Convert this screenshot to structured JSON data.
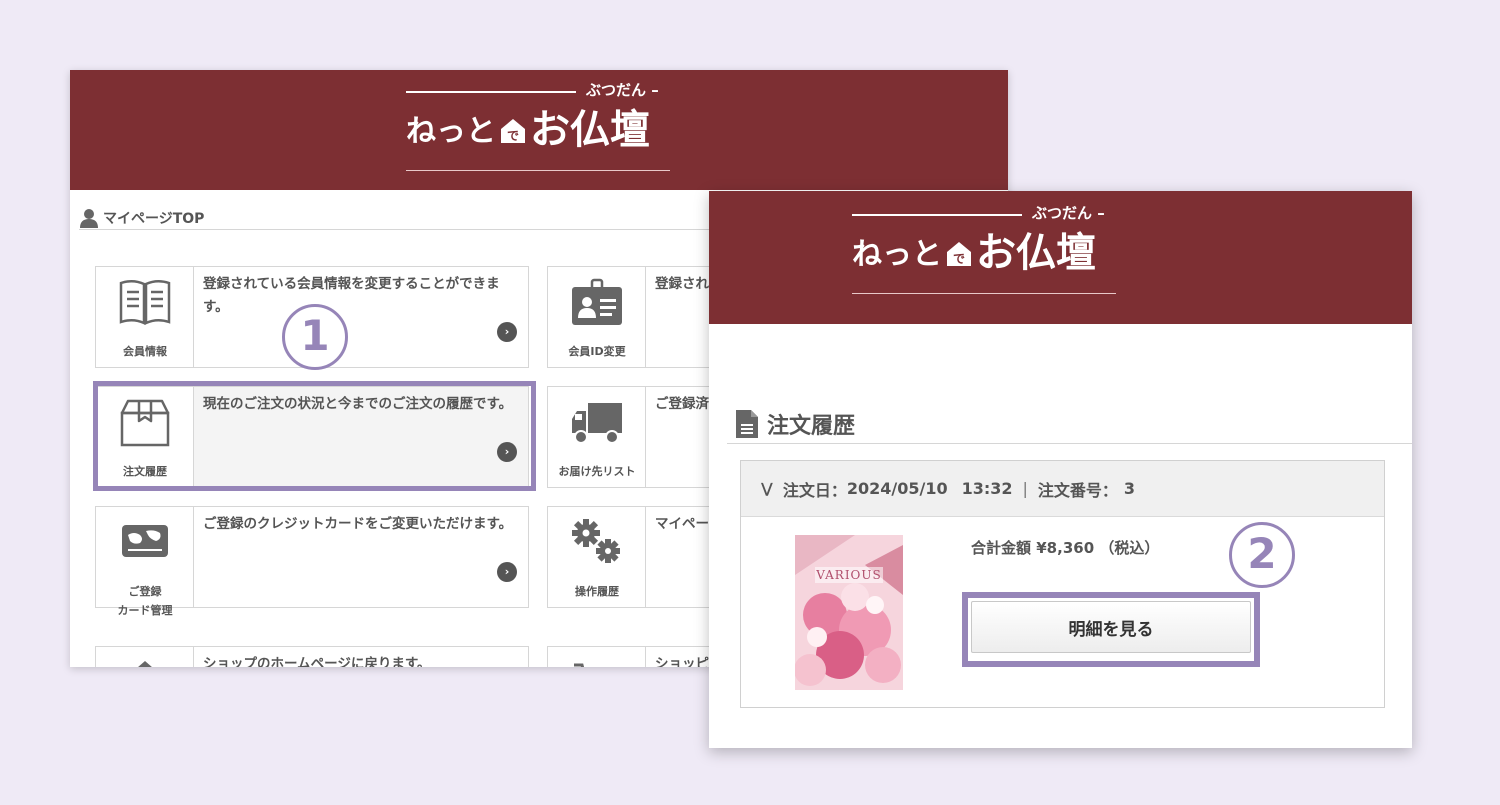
{
  "logo": {
    "ruby": "ぶつだん",
    "main_a": "ねっと",
    "main_b": "お仏壇"
  },
  "mypage": {
    "heading": "マイページTOP",
    "cards": [
      {
        "label": "会員情報",
        "desc": "登録されている会員情報を変更することができます。",
        "icon": "open-book-icon"
      },
      {
        "label": "会員ID変更",
        "desc": "登録されている会員IDを変更することができます。",
        "icon": "id-card-icon"
      },
      {
        "label": "注文履歴",
        "desc": "現在のご注文の状況と今までのご注文の履歴です。",
        "icon": "box-icon"
      },
      {
        "label": "お届け先リスト",
        "desc": "ご登録済のお届け先を変更することができます。",
        "icon": "truck-icon"
      },
      {
        "label1": "ご登録",
        "label2": "カード管理",
        "desc": "ご登録のクレジットカードをご変更いただけます。",
        "icon": "credit-card-icon"
      },
      {
        "label": "操作履歴",
        "desc": "マイページの操作履歴をご確認いただけます。",
        "icon": "gears-icon"
      },
      {
        "label": "",
        "desc": "ショップのホームページに戻ります。",
        "icon": "home-icon"
      },
      {
        "label": "",
        "desc": "ショッピングカートへ",
        "icon": "cart-icon"
      }
    ]
  },
  "steps": {
    "one": "1",
    "two": "2"
  },
  "orders": {
    "heading": "注文履歴",
    "date_label": "注文日：",
    "date": "2024/05/10",
    "time": "13:32",
    "number_label": "注文番号：",
    "number": "3",
    "total_label": "合計金額",
    "total_value": "¥8,360",
    "tax": "（税込）",
    "detail_button": "明細を見る",
    "product_title": "VARIOUS"
  },
  "colors": {
    "brand": "#7d2f33",
    "highlight": "#9685b8",
    "icon_gray": "#666666"
  }
}
